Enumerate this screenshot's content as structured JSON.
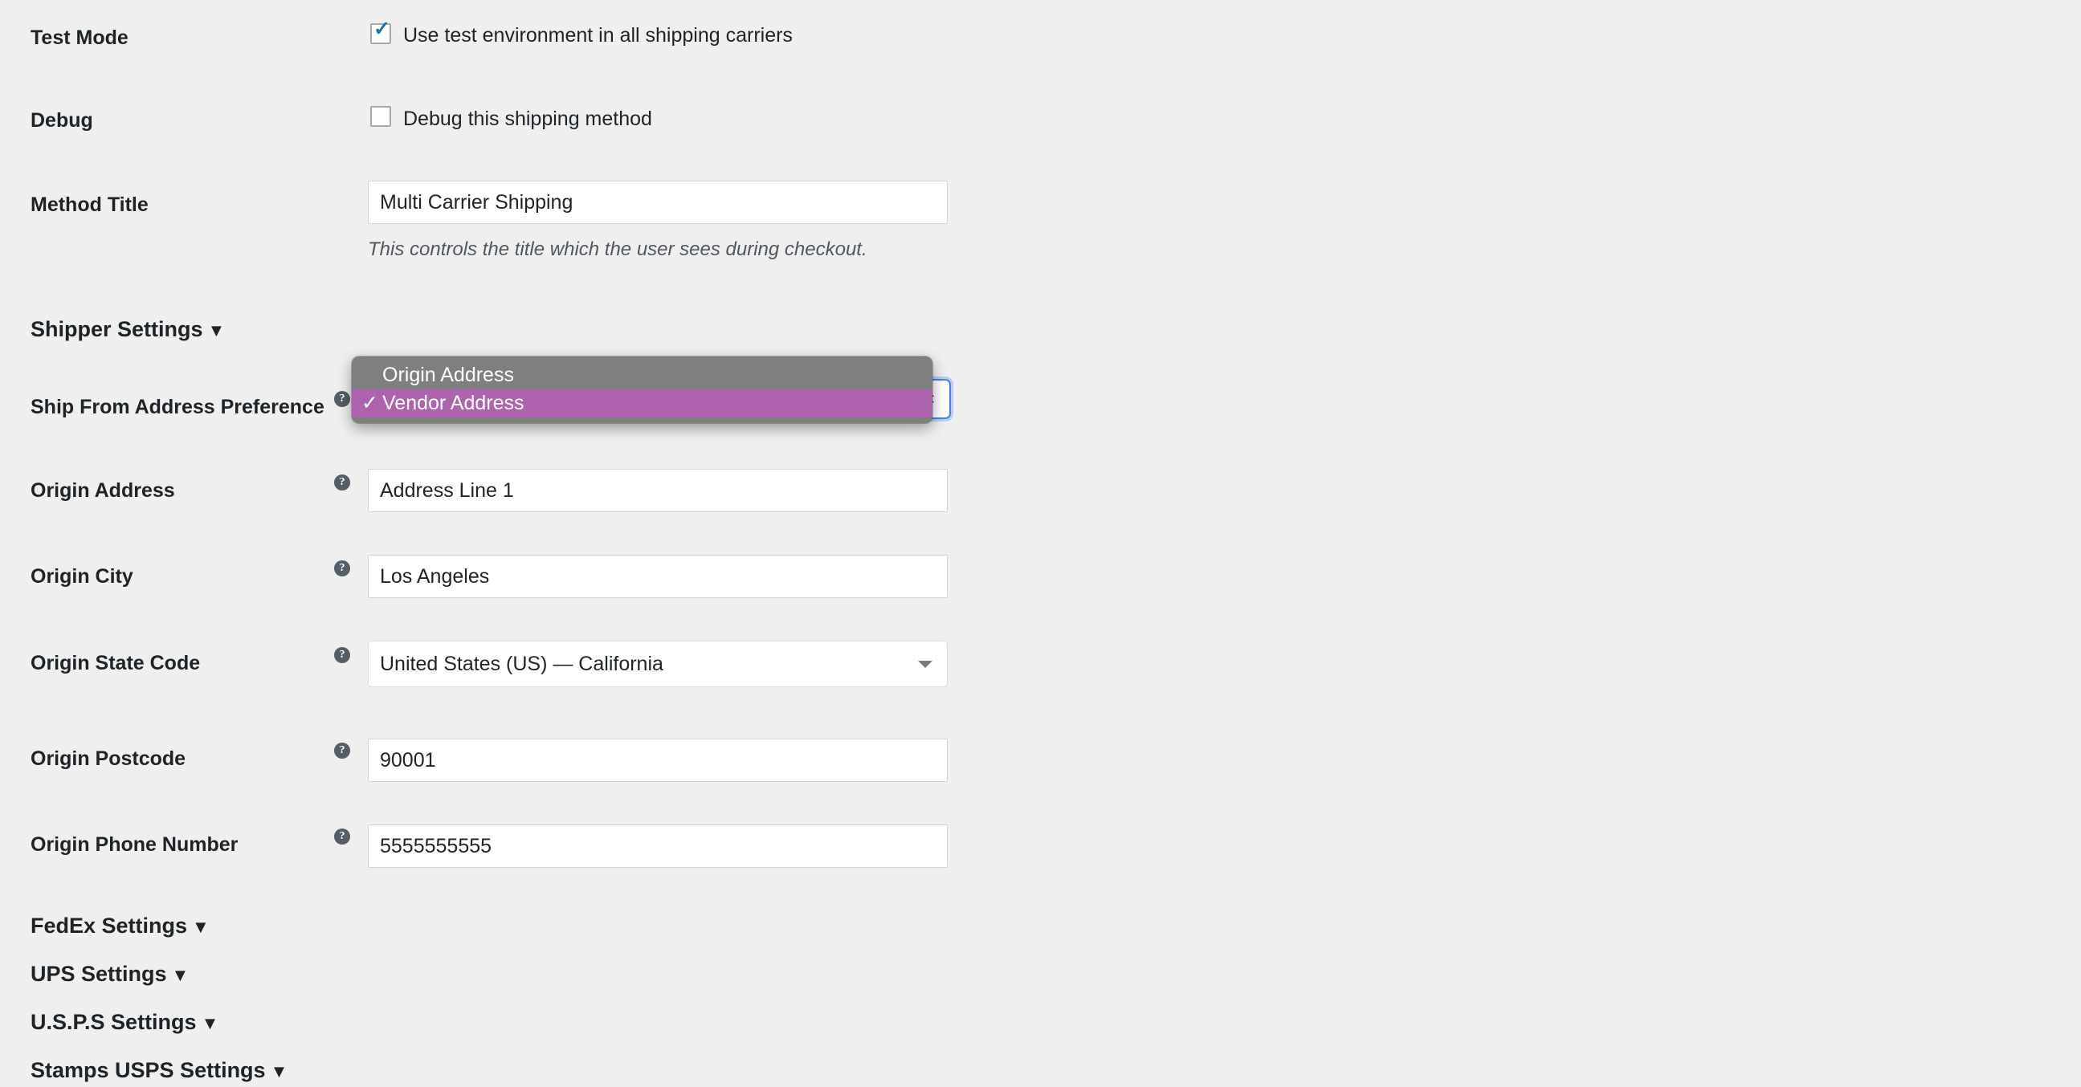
{
  "page": {
    "background": "#efefef",
    "accent_checkbox": "#1d72aa",
    "focus_ring": "#3a86e8",
    "dropdown_bg": "#7f7f7f",
    "dropdown_selected_bg": "#ad63ae"
  },
  "rows": {
    "test_mode": {
      "label": "Test Mode",
      "checkbox_label": "Use test environment in all shipping carriers",
      "checked": true,
      "tick": "✓"
    },
    "debug": {
      "label": "Debug",
      "checkbox_label": "Debug this shipping method",
      "checked": false
    },
    "method_title": {
      "label": "Method Title",
      "value": "Multi Carrier Shipping",
      "description": "This controls the title which the user sees during checkout."
    },
    "ship_from_address_preference": {
      "label": "Ship From Address Preference",
      "help": "?",
      "selected": "Vendor Address",
      "options": [
        "Origin Address",
        "Vendor Address"
      ],
      "check_glyph": "✓",
      "open": true
    },
    "origin_address": {
      "label": "Origin Address",
      "help": "?",
      "value": "Address Line 1"
    },
    "origin_city": {
      "label": "Origin City",
      "help": "?",
      "value": "Los Angeles"
    },
    "origin_state_code": {
      "label": "Origin State Code",
      "help": "?",
      "value": "United States (US) — California"
    },
    "origin_postcode": {
      "label": "Origin Postcode",
      "help": "?",
      "value": "90001"
    },
    "origin_phone_number": {
      "label": "Origin Phone Number",
      "help": "?",
      "value": "5555555555"
    }
  },
  "sections": {
    "shipper": {
      "label": "Shipper Settings",
      "caret": "▼"
    },
    "fedex": {
      "label": "FedEx Settings",
      "caret": "▼"
    },
    "ups": {
      "label": "UPS Settings",
      "caret": "▼"
    },
    "usps": {
      "label": "U.S.P.S Settings",
      "caret": "▼"
    },
    "stamps": {
      "label": "Stamps USPS Settings",
      "caret": "▼"
    }
  }
}
